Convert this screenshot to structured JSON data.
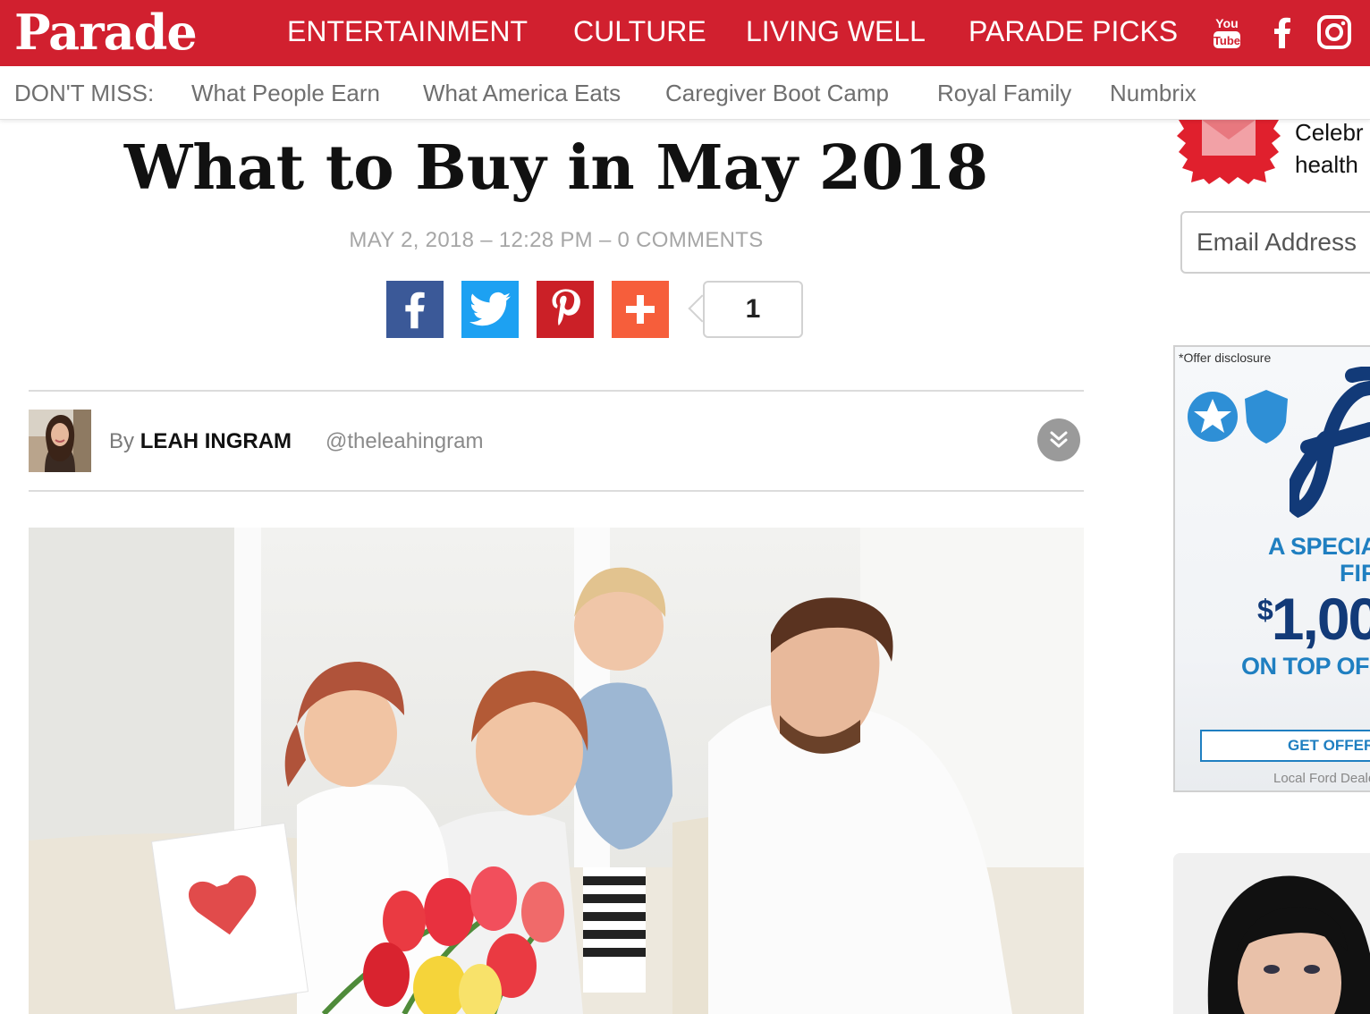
{
  "header": {
    "logo": "Parade",
    "nav": [
      "ENTERTAINMENT",
      "CULTURE",
      "LIVING WELL",
      "PARADE PICKS"
    ],
    "social": [
      "youtube-icon",
      "facebook-icon",
      "instagram-icon"
    ],
    "youtube_label_top": "You",
    "youtube_label_bottom": "Tube"
  },
  "dont_miss": {
    "label": "DON'T MISS:",
    "links": [
      "What People Earn",
      "What America Eats",
      "Caregiver Boot Camp",
      "Royal Family",
      "Numbrix"
    ]
  },
  "article": {
    "title": "What to Buy in May 2018",
    "date": "MAY 2, 2018 – 12:28 PM",
    "comments": "– 0 COMMENTS",
    "share_count": "1",
    "author_prefix": "By",
    "author": "LEAH INGRAM",
    "handle": "@theleahingram"
  },
  "sidebar": {
    "newsletter_line1": "Celebr",
    "newsletter_line2": "health",
    "email_placeholder": "Email Address",
    "ad": {
      "disclosure": "*Offer disclosure",
      "special": "A SPECIAL",
      "first": "FIR",
      "amount_symbol": "$",
      "amount": "1,00",
      "on_top": "ON TOP OF A",
      "button": "GET OFFER",
      "local": "Local Ford Deale"
    }
  },
  "colors": {
    "brand_red": "#d1202f",
    "facebook": "#3b5998",
    "twitter": "#1da1f2",
    "pinterest": "#cb2027",
    "addthis": "#f65e3b",
    "ford_blue": "#123a78"
  }
}
